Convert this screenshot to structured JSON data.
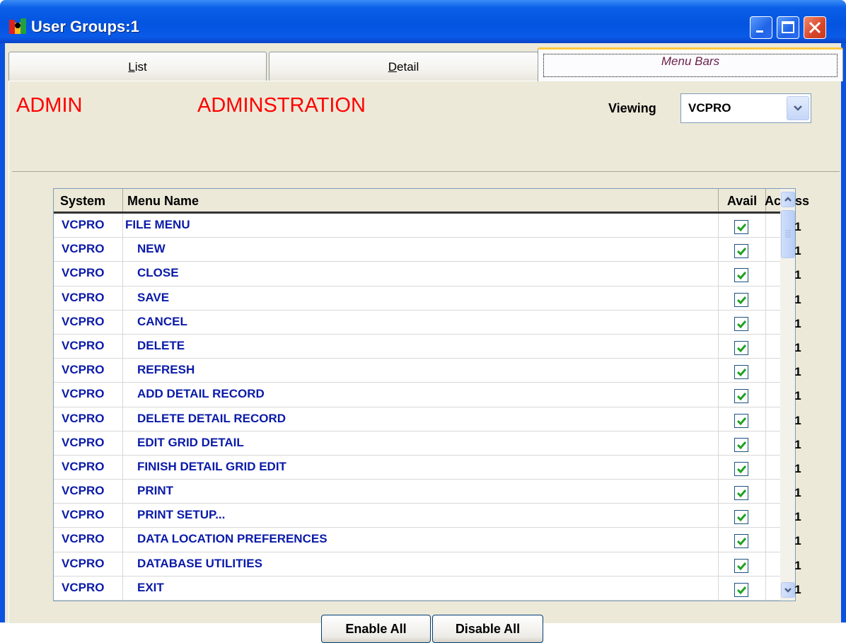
{
  "window": {
    "title": "User Groups:1"
  },
  "tabs": [
    {
      "label": "List",
      "hotkey": "L",
      "rest": "ist"
    },
    {
      "label": "Detail",
      "hotkey": "D",
      "rest": "etail"
    },
    {
      "label": "Menu Bars"
    }
  ],
  "header": {
    "group_code": "ADMIN",
    "group_name": "ADMINSTRATION",
    "viewing_label": "Viewing",
    "viewing_value": "VCPRO"
  },
  "grid": {
    "columns": [
      "System",
      "Menu Name",
      "Avail",
      "Access"
    ],
    "rows": [
      {
        "system": "VCPRO",
        "name": "FILE MENU",
        "avail": true,
        "access": "1"
      },
      {
        "system": "VCPRO",
        "name": "NEW",
        "avail": true,
        "access": "1"
      },
      {
        "system": "VCPRO",
        "name": "CLOSE",
        "avail": true,
        "access": "1"
      },
      {
        "system": "VCPRO",
        "name": "SAVE",
        "avail": true,
        "access": "1"
      },
      {
        "system": "VCPRO",
        "name": "CANCEL",
        "avail": true,
        "access": "1"
      },
      {
        "system": "VCPRO",
        "name": "DELETE",
        "avail": true,
        "access": "1"
      },
      {
        "system": "VCPRO",
        "name": "REFRESH",
        "avail": true,
        "access": "1"
      },
      {
        "system": "VCPRO",
        "name": "ADD DETAIL RECORD",
        "avail": true,
        "access": "1"
      },
      {
        "system": "VCPRO",
        "name": "DELETE DETAIL RECORD",
        "avail": true,
        "access": "1"
      },
      {
        "system": "VCPRO",
        "name": "EDIT GRID DETAIL",
        "avail": true,
        "access": "1"
      },
      {
        "system": "VCPRO",
        "name": "FINISH DETAIL GRID EDIT",
        "avail": true,
        "access": "1"
      },
      {
        "system": "VCPRO",
        "name": "PRINT",
        "avail": true,
        "access": "1"
      },
      {
        "system": "VCPRO",
        "name": "PRINT SETUP...",
        "avail": true,
        "access": "1"
      },
      {
        "system": "VCPRO",
        "name": "DATA LOCATION PREFERENCES",
        "avail": true,
        "access": "1"
      },
      {
        "system": "VCPRO",
        "name": "DATABASE UTILITIES",
        "avail": true,
        "access": "1"
      },
      {
        "system": "VCPRO",
        "name": "EXIT",
        "avail": true,
        "access": "1"
      }
    ]
  },
  "buttons": {
    "enable_all": "Enable All",
    "disable_all": "Disable All"
  },
  "colors": {
    "title_bar": "#0a53e0",
    "header_text": "#ff0000",
    "grid_text": "#0a1aa8",
    "checkbox": "#21a121"
  }
}
